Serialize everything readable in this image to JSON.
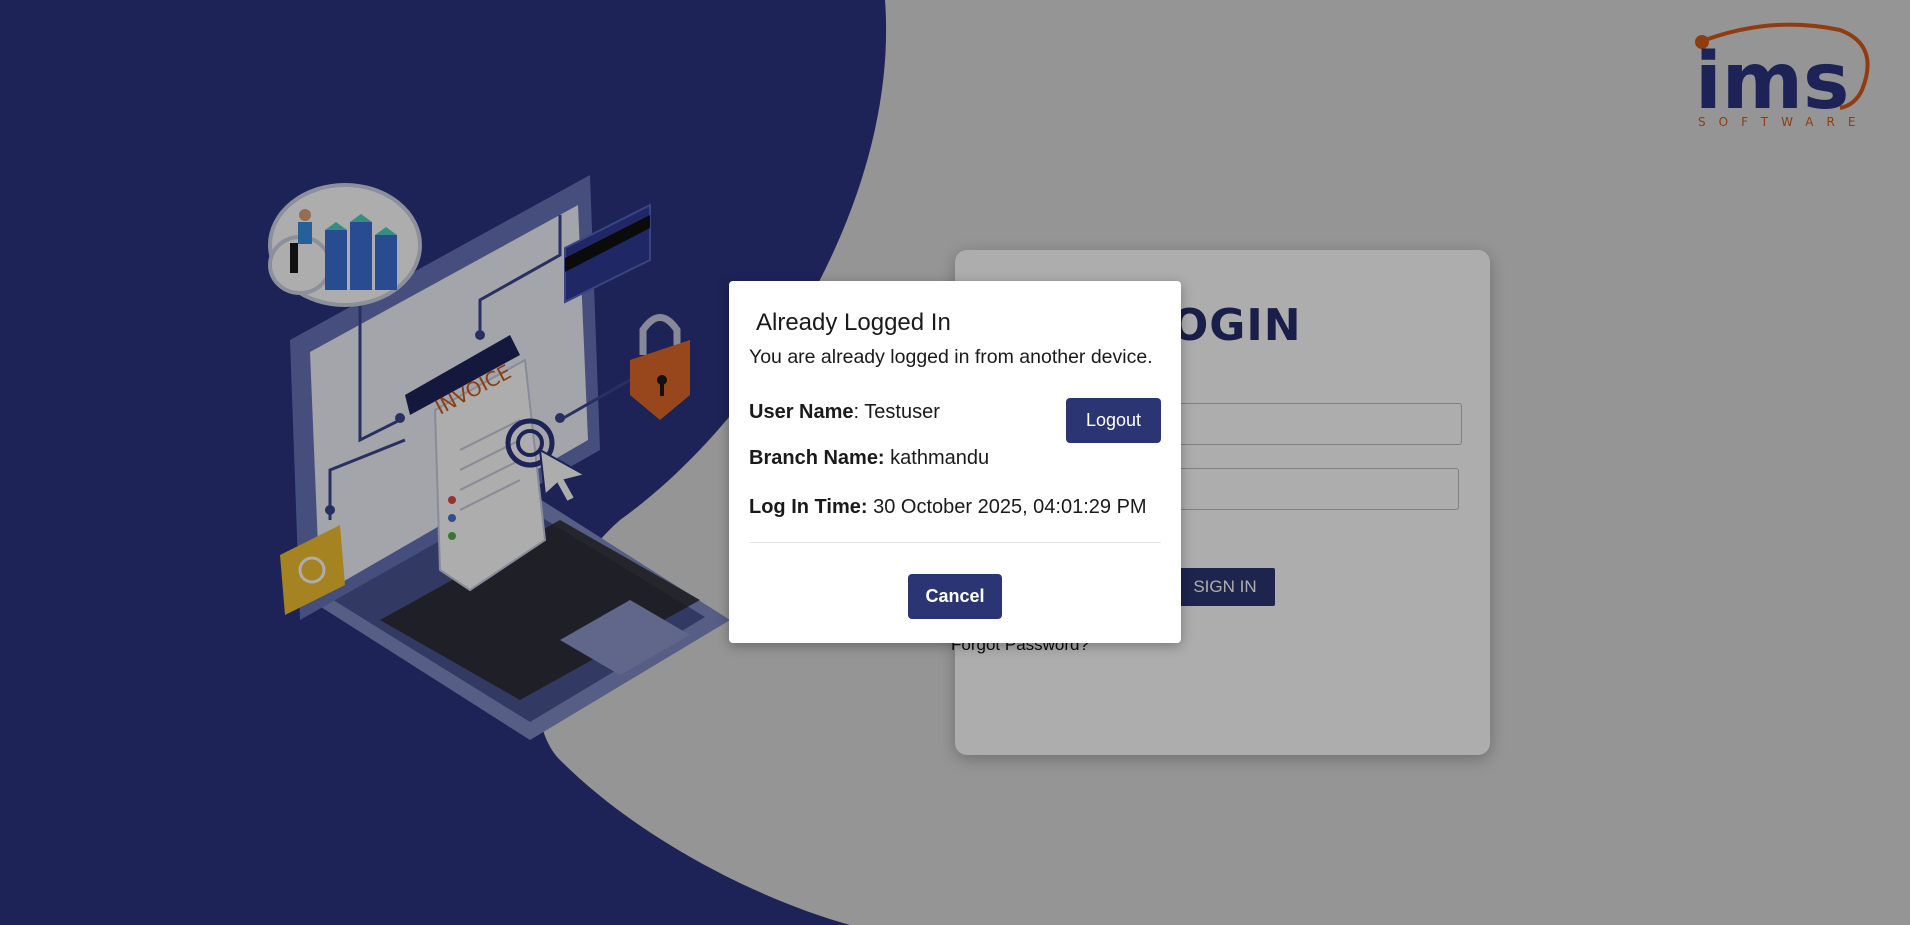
{
  "brand": {
    "logo_text": "ims",
    "logo_subtext": "SOFTWARE",
    "primary_color": "#252e6b",
    "accent_color": "#d35a18"
  },
  "illustration": {
    "invoice_label": "INVOICE"
  },
  "login": {
    "title": "LOGIN",
    "username_placeholder": "",
    "password_placeholder": "",
    "signin_label": "SIGN IN",
    "forgot_label": "Forgot Password?"
  },
  "modal": {
    "title": "Already Logged In",
    "message": "You are already logged in from another device.",
    "user_label": "User Name",
    "user_value": "Testuser",
    "branch_label": "Branch Name:",
    "branch_value": "kathmandu",
    "time_label": "Log In Time:",
    "time_value": "30 October 2025, 04:01:29 PM",
    "logout_label": "Logout",
    "cancel_label": "Cancel"
  }
}
